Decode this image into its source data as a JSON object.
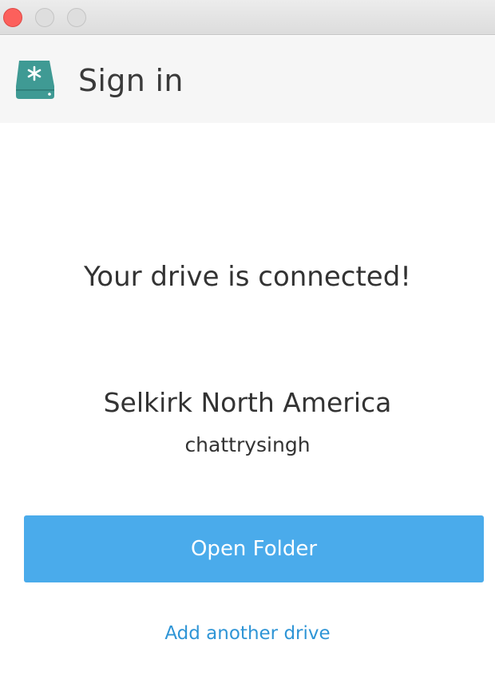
{
  "window": {
    "controls": [
      "close",
      "minimize",
      "maximize"
    ]
  },
  "header": {
    "icon": "drive-icon",
    "title": "Sign in",
    "icon_color": "#3f9a94"
  },
  "main": {
    "status_text": "Your drive is connected!",
    "drive_name": "Selkirk North America",
    "username": "chattrysingh",
    "open_button_label": "Open Folder",
    "add_drive_link": "Add another drive"
  },
  "colors": {
    "accent": "#4aabeb",
    "link": "#2f95d6",
    "close": "#fc605c"
  }
}
